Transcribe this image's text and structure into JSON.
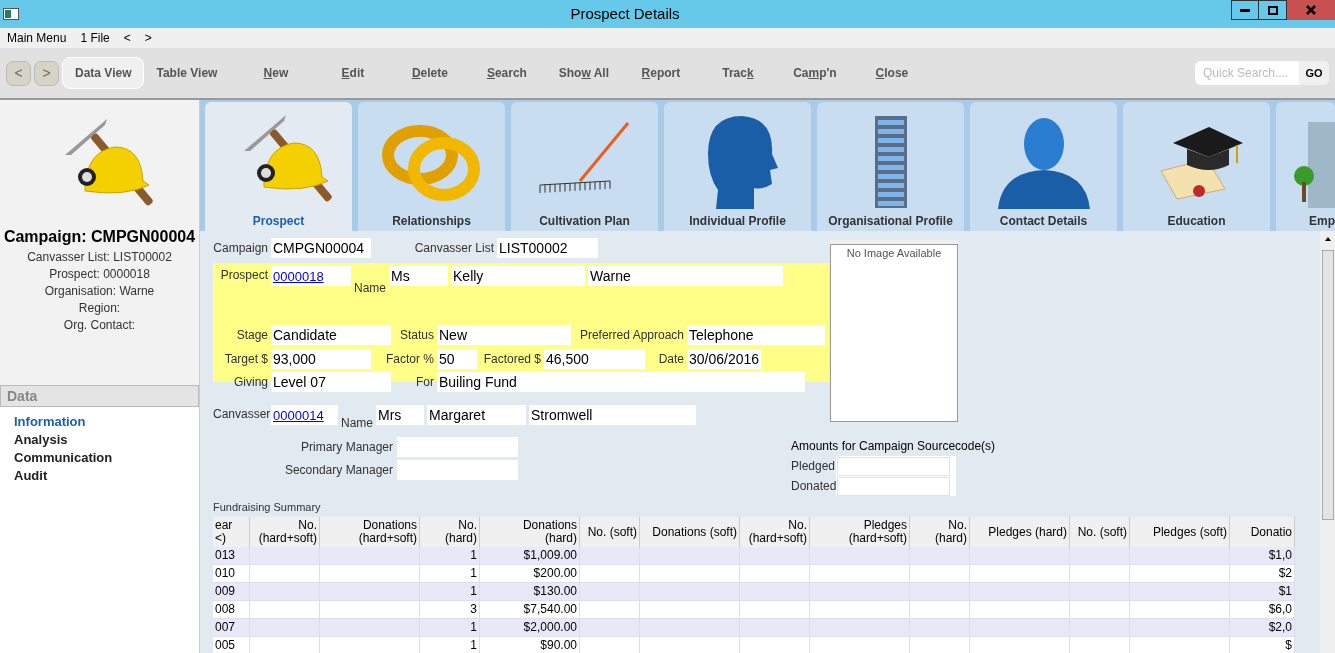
{
  "window": {
    "title": "Prospect Details"
  },
  "menu": [
    "Main Menu",
    "1 File",
    "<",
    ">"
  ],
  "toolbar": {
    "nav": [
      "<",
      ">"
    ],
    "views": [
      {
        "label": "Data View",
        "selected": true
      },
      {
        "label": "Table View",
        "selected": false
      }
    ],
    "actions": [
      {
        "key": "N",
        "post": "ew"
      },
      {
        "key": "E",
        "post": "dit"
      },
      {
        "key": "D",
        "post": "elete"
      },
      {
        "key": "S",
        "post": "earch"
      },
      {
        "pre": "Sho",
        "key": "w",
        "post": " All"
      },
      {
        "key": "R",
        "post": "eport"
      },
      {
        "pre": "Trac",
        "key": "k"
      },
      {
        "pre": "Ca",
        "key": "m",
        "post": "p'n"
      },
      {
        "key": "C",
        "post": "lose"
      }
    ],
    "quick_search": {
      "placeholder": "Quick Search....",
      "button": "GO"
    }
  },
  "sidebar": {
    "title": "Campaign: CMPGN00004",
    "lines": [
      "Canvasser List: LIST00002",
      "Prospect: 0000018",
      "Organisation: Warne",
      "Region:",
      "Org. Contact:"
    ],
    "section": "Data",
    "items": [
      {
        "label": "Information",
        "selected": true
      },
      {
        "label": "Analysis",
        "selected": false
      },
      {
        "label": "Communication",
        "selected": false
      },
      {
        "label": "Audit",
        "selected": false
      }
    ]
  },
  "tabs": [
    {
      "label": "Prospect",
      "selected": true
    },
    {
      "label": "Relationships",
      "selected": false
    },
    {
      "label": "Cultivation Plan",
      "selected": false
    },
    {
      "label": "Individual Profile",
      "selected": false
    },
    {
      "label": "Organisational Profile",
      "selected": false
    },
    {
      "label": "Contact Details",
      "selected": false
    },
    {
      "label": "Education",
      "selected": false
    },
    {
      "label": "Emp",
      "selected": false
    }
  ],
  "form": {
    "campaign": {
      "label": "Campaign",
      "value": "CMPGN00004"
    },
    "canvasser_list": {
      "label": "Canvasser List",
      "value": "LIST00002"
    },
    "prospect": {
      "label": "Prospect",
      "value": "0000018"
    },
    "name": {
      "label": "Name",
      "values": [
        "Ms",
        "Kelly",
        "Warne"
      ]
    },
    "stage": {
      "label": "Stage",
      "value": "Candidate"
    },
    "status": {
      "label": "Status",
      "value": "New"
    },
    "preferred_approach": {
      "label": "Preferred Approach",
      "value": "Telephone"
    },
    "target": {
      "label": "Target $",
      "value": "93,000"
    },
    "factor": {
      "label": "Factor %",
      "value": "50"
    },
    "factored": {
      "label": "Factored $",
      "value": "46,500"
    },
    "date": {
      "label": "Date",
      "value": "30/06/2016"
    },
    "giving": {
      "label": "Giving",
      "value": "Level 07"
    },
    "for": {
      "label": "For",
      "value": "Builing Fund"
    },
    "canvasser": {
      "label": "Canvasser",
      "value": "0000014"
    },
    "canvasser_name": {
      "label": "Name",
      "values": [
        "Mrs",
        "Margaret",
        "Stromwell"
      ]
    },
    "primary_manager": {
      "label": "Primary Manager"
    },
    "secondary_manager": {
      "label": "Secondary Manager"
    },
    "image_box": {
      "text": "No Image Available"
    },
    "amounts": {
      "title": "Amounts for Campaign Sourcecode(s)",
      "fields": [
        {
          "label": "Pledged"
        },
        {
          "label": "Donated"
        }
      ]
    }
  },
  "summary": {
    "title": "Fundraising Summary",
    "columns": [
      "ear\n<)",
      "No.\n(hard+soft)",
      "Donations\n(hard+soft)",
      "No.\n(hard)",
      "Donations\n(hard)",
      "No. (soft)",
      "Donations (soft)",
      "No.\n(hard+soft)",
      "Pledges\n(hard+soft)",
      "No.\n(hard)",
      "Pledges (hard)",
      "No. (soft)",
      "Pledges (soft)",
      "Donatio"
    ],
    "rows": [
      [
        "013",
        null,
        null,
        "1",
        "$1,009.00",
        null,
        null,
        null,
        null,
        null,
        null,
        null,
        null,
        "$1,0"
      ],
      [
        "010",
        null,
        null,
        "1",
        "$200.00",
        null,
        null,
        null,
        null,
        null,
        null,
        null,
        null,
        "$2"
      ],
      [
        "009",
        null,
        null,
        "1",
        "$130.00",
        null,
        null,
        null,
        null,
        null,
        null,
        null,
        null,
        "$1"
      ],
      [
        "008",
        null,
        null,
        "3",
        "$7,540.00",
        null,
        null,
        null,
        null,
        null,
        null,
        null,
        null,
        "$6,0"
      ],
      [
        "007",
        null,
        null,
        "1",
        "$2,000.00",
        null,
        null,
        null,
        null,
        null,
        null,
        null,
        null,
        "$2,0"
      ],
      [
        "005",
        null,
        null,
        "1",
        "$90.00",
        null,
        null,
        null,
        null,
        null,
        null,
        null,
        null,
        "$"
      ]
    ]
  }
}
